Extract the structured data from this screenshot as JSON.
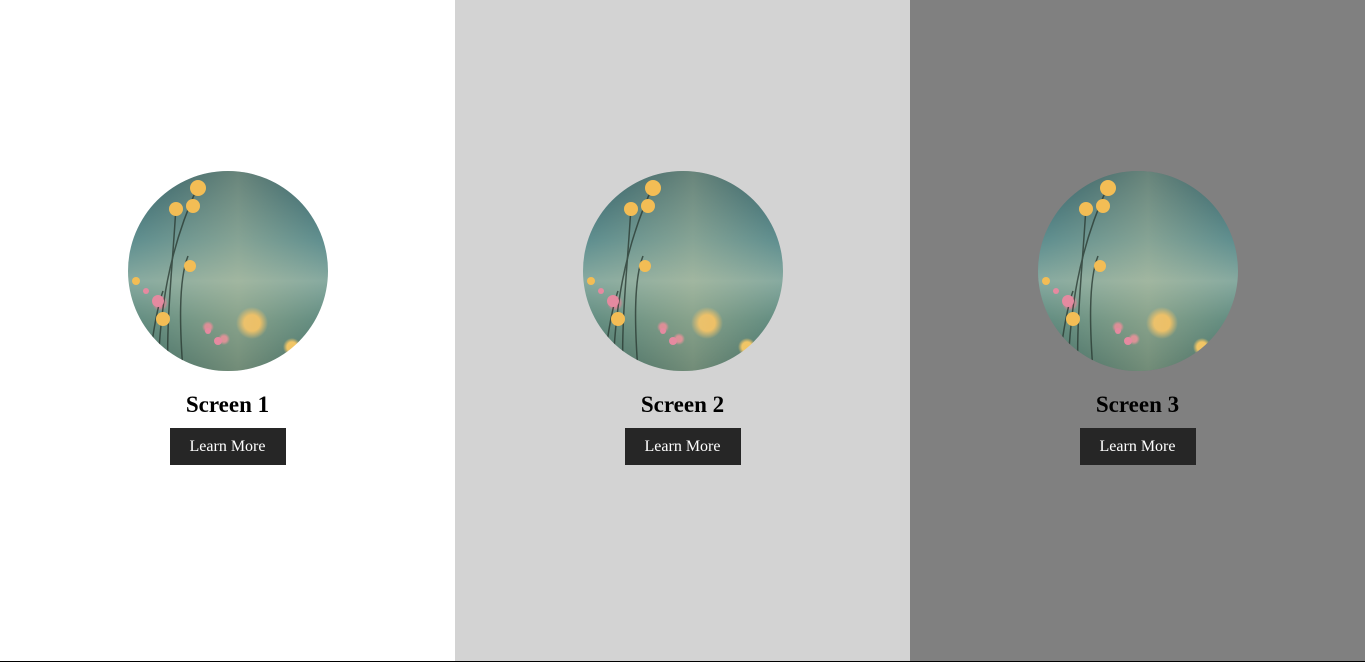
{
  "panels": [
    {
      "title": "Screen 1",
      "button_label": "Learn More",
      "background": "#ffffff"
    },
    {
      "title": "Screen 2",
      "button_label": "Learn More",
      "background": "#d3d3d3"
    },
    {
      "title": "Screen 3",
      "button_label": "Learn More",
      "background": "#808080"
    }
  ],
  "colors": {
    "button_bg": "#262626",
    "button_text": "#ffffff",
    "title_text": "#000000"
  }
}
